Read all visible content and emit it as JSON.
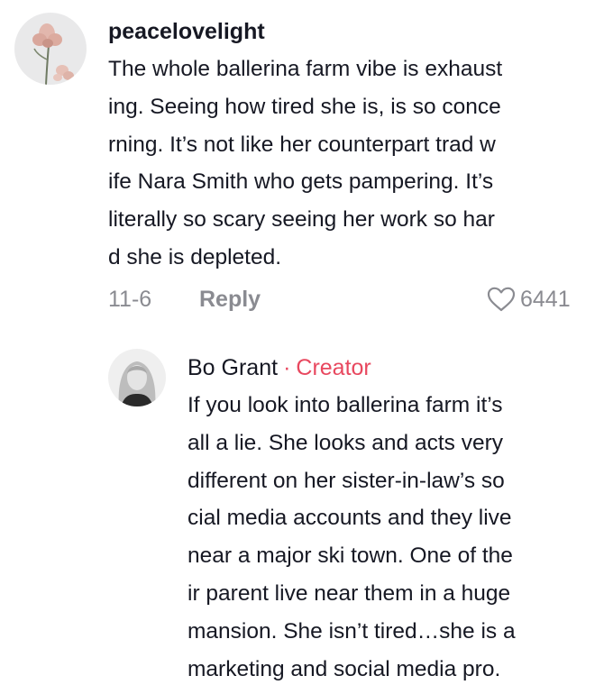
{
  "comment": {
    "username": "peacelovelight",
    "avatar": "iris-flower-avatar",
    "text_lines": [
      "The whole ballerina farm vibe is exhaust",
      "ing. Seeing how tired she is, is so conce",
      "rning. It’s not like her counterpart trad w",
      "ife Nara Smith who gets pampering. It’s",
      "literally so scary seeing her work so har",
      "d she is depleted."
    ],
    "date": "11-6",
    "reply_label": "Reply",
    "like_icon": "heart-outline-icon",
    "like_count": "6441"
  },
  "reply": {
    "username": "Bo Grant",
    "separator": "·",
    "badge": "Creator",
    "avatar": "profile-photo-avatar",
    "text_lines": [
      "If you look into ballerina farm it’s",
      "all a lie. She looks and acts very",
      "different on her sister-in-law’s so",
      "cial media accounts and they live",
      "near a major ski town. One of the",
      "ir parent live near them in a huge",
      "mansion. She isn’t tired…she is a",
      "marketing and social media pro."
    ]
  },
  "colors": {
    "text": "#161823",
    "muted": "#8a8b91",
    "creator_accent": "#e8485f",
    "background": "#ffffff"
  }
}
